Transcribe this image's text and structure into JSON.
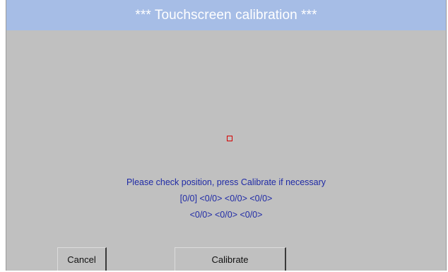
{
  "window": {
    "title": "***  Touchscreen calibration  ***"
  },
  "calibration": {
    "instruction": "Please check position, press Calibrate if necessary",
    "coords_line1": "[0/0] <0/0> <0/0> <0/0>",
    "coords_line2": "<0/0> <0/0> <0/0>",
    "target_color": "#d40000"
  },
  "buttons": {
    "cancel_label": "Cancel",
    "calibrate_label": "Calibrate"
  },
  "colors": {
    "titlebar_bg": "#a6bde6",
    "panel_bg": "#c0c0c0",
    "text_blue": "#1f2aa6"
  }
}
